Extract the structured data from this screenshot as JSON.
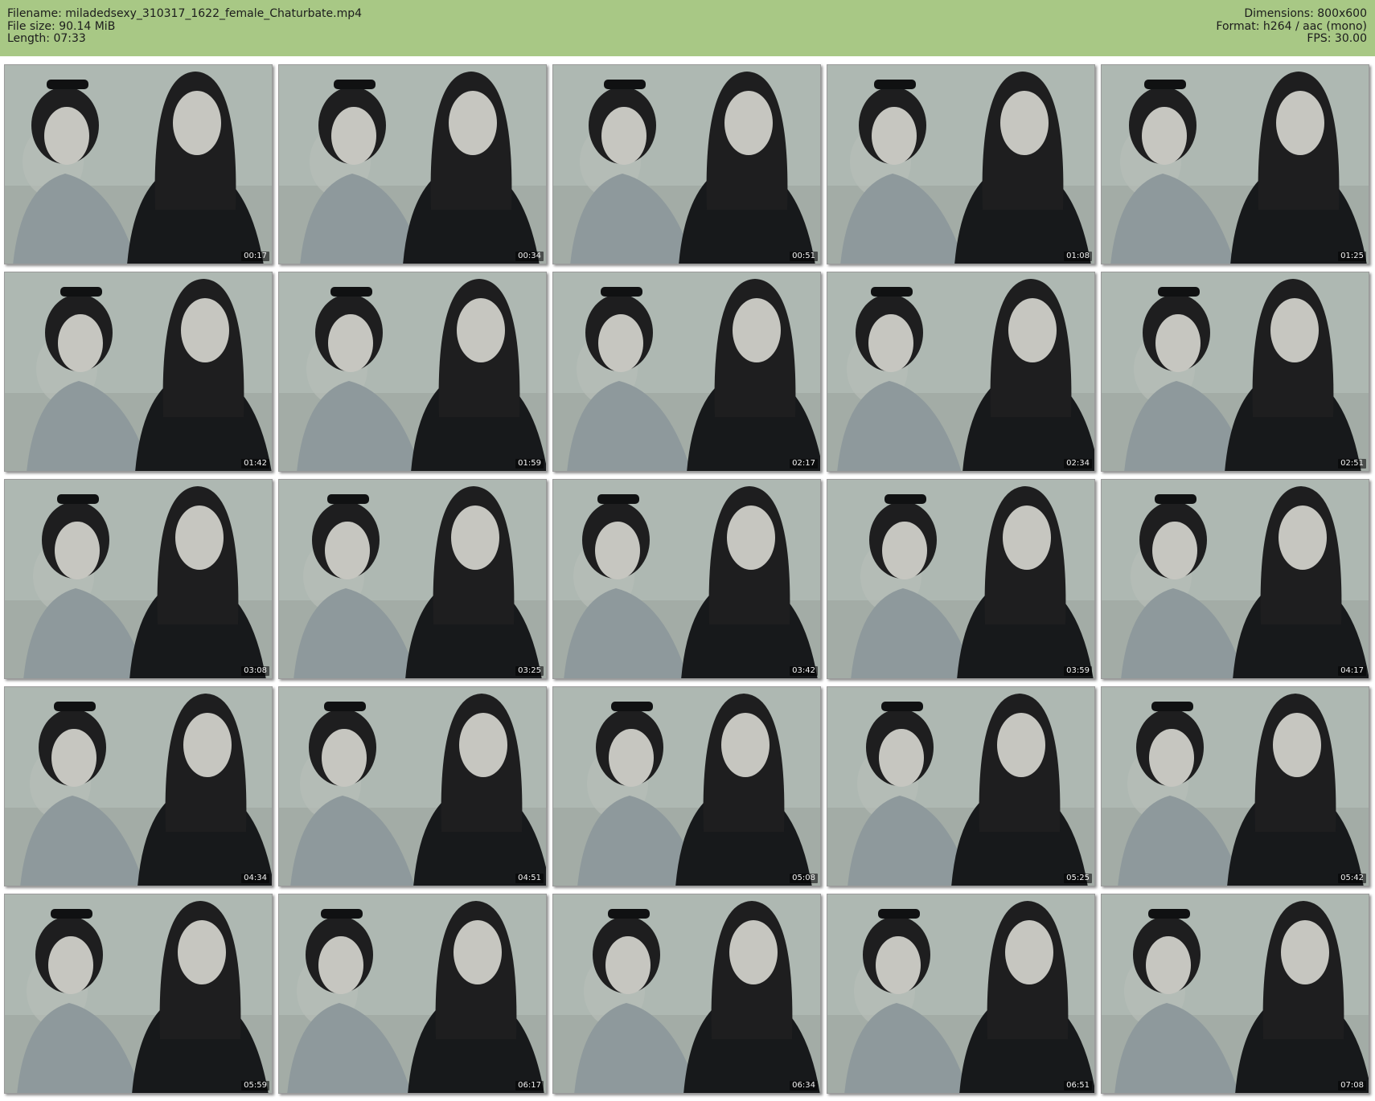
{
  "header": {
    "left": [
      "Filename: miladedsexy_310317_1622_female_Chaturbate.mp4",
      "File size: 90.14 MiB",
      "Length: 07:33"
    ],
    "right": [
      "Dimensions: 800x600",
      "Format: h264 / aac (mono)",
      "FPS: 30.00"
    ]
  },
  "thumbnails": [
    {
      "time": "00:17"
    },
    {
      "time": "00:34"
    },
    {
      "time": "00:51"
    },
    {
      "time": "01:08"
    },
    {
      "time": "01:25"
    },
    {
      "time": "01:42"
    },
    {
      "time": "01:59"
    },
    {
      "time": "02:17"
    },
    {
      "time": "02:34"
    },
    {
      "time": "02:51"
    },
    {
      "time": "03:08"
    },
    {
      "time": "03:25"
    },
    {
      "time": "03:42"
    },
    {
      "time": "03:59"
    },
    {
      "time": "04:17"
    },
    {
      "time": "04:34"
    },
    {
      "time": "04:51"
    },
    {
      "time": "05:08"
    },
    {
      "time": "05:25"
    },
    {
      "time": "05:42"
    },
    {
      "time": "05:59"
    },
    {
      "time": "06:17"
    },
    {
      "time": "06:34"
    },
    {
      "time": "06:51"
    },
    {
      "time": "07:08"
    }
  ],
  "colors": {
    "header_bg": "#a8c885",
    "frame_bg": "#aeb8b2",
    "sweater": "#8e999c",
    "dark_outfit": "#17191b",
    "hair": "#1e1e1f",
    "skin": "#c6c6c0"
  }
}
